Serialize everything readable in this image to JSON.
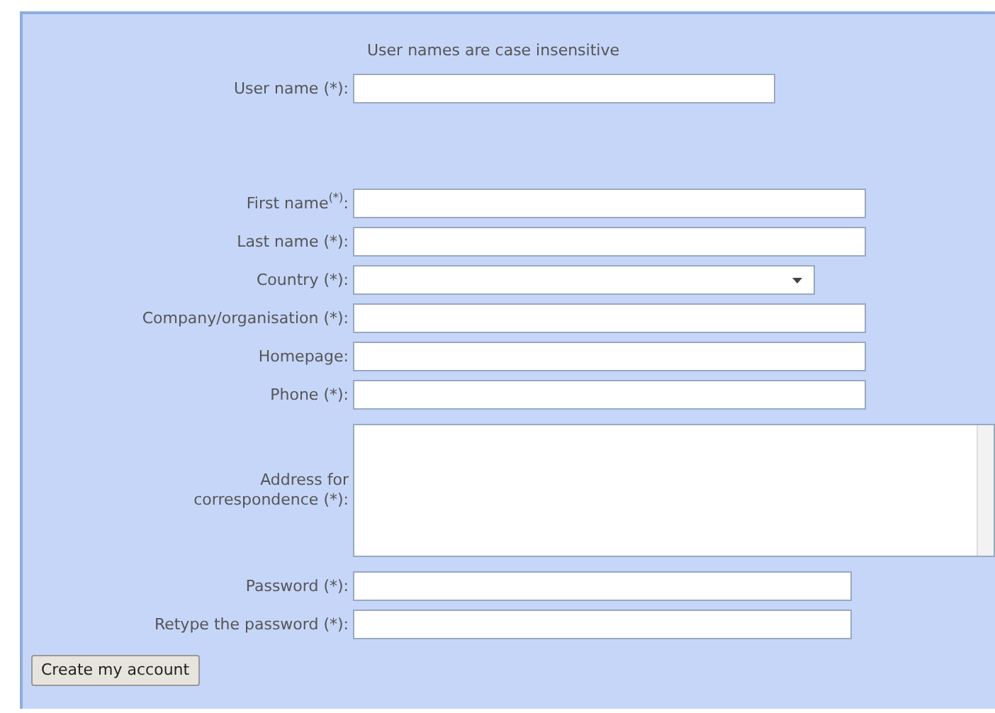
{
  "hint": "User names are case insensitive",
  "fields": [
    {
      "kind": "text",
      "label": "User name (*):"
    },
    {
      "kind": "gap"
    },
    {
      "kind": "text",
      "label": "First name$^{(*)}$:"
    },
    {
      "kind": "text",
      "label": "Last name (*):"
    },
    {
      "kind": "select",
      "label": "Country (*):"
    },
    {
      "kind": "text",
      "label": "Company/organisation (*):"
    },
    {
      "kind": "text",
      "label": "Homepage:"
    },
    {
      "kind": "text",
      "label": "Phone (*):"
    },
    {
      "kind": "textarea",
      "label": "Address for correspondence (*):"
    },
    {
      "kind": "password",
      "label": "Password (*):"
    },
    {
      "kind": "password",
      "label": "Retype the password (*):"
    }
  ],
  "submit": "Create my account"
}
